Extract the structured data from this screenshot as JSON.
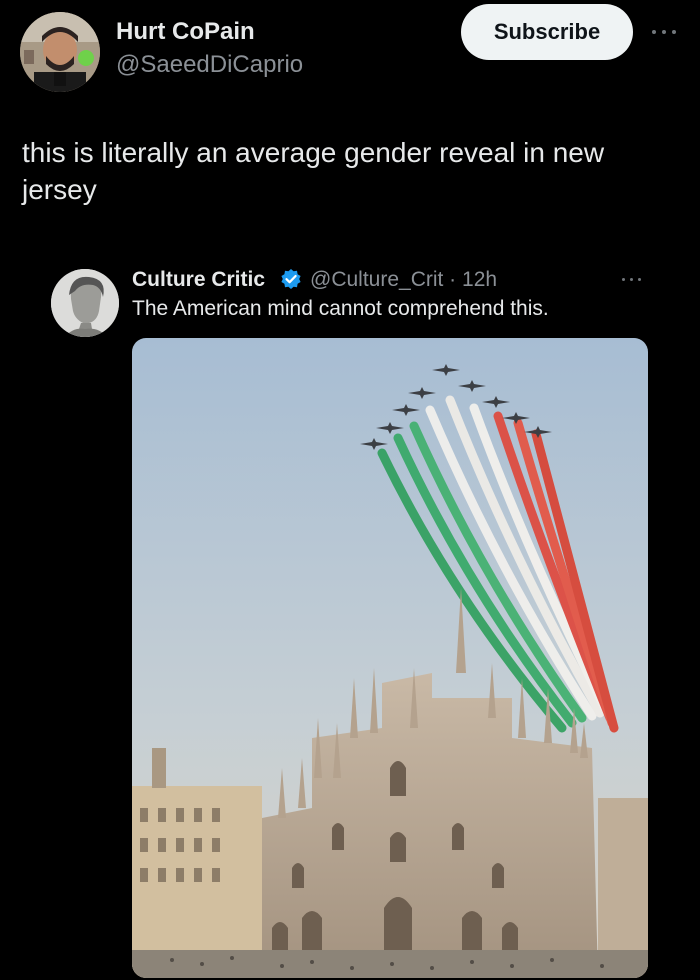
{
  "post": {
    "author": {
      "display_name": "Hurt CoPain",
      "handle": "@SaeedDiCaprio",
      "avatar_icon": "profile-photo"
    },
    "subscribe_label": "Subscribe",
    "text": "this is literally an average gender reveal in new jersey",
    "more_icon": "ellipsis-icon"
  },
  "quoted_post": {
    "author": {
      "display_name": "Culture Critic",
      "verified": true,
      "handle_time": "@Culture_Crit · 12h",
      "avatar_icon": "statue-bust-avatar"
    },
    "text": "The American mind cannot comprehend this.",
    "media": {
      "description_icon": "cathedral-photo",
      "smoke_colors": [
        "#2e9f5c",
        "#f4f2ee",
        "#e0463a"
      ]
    }
  },
  "colors": {
    "background": "#000000",
    "primary_text": "#e7e9ea",
    "secondary_text": "#8b9096",
    "verified_blue": "#1d9bf0",
    "button_bg": "#eff3f4"
  }
}
